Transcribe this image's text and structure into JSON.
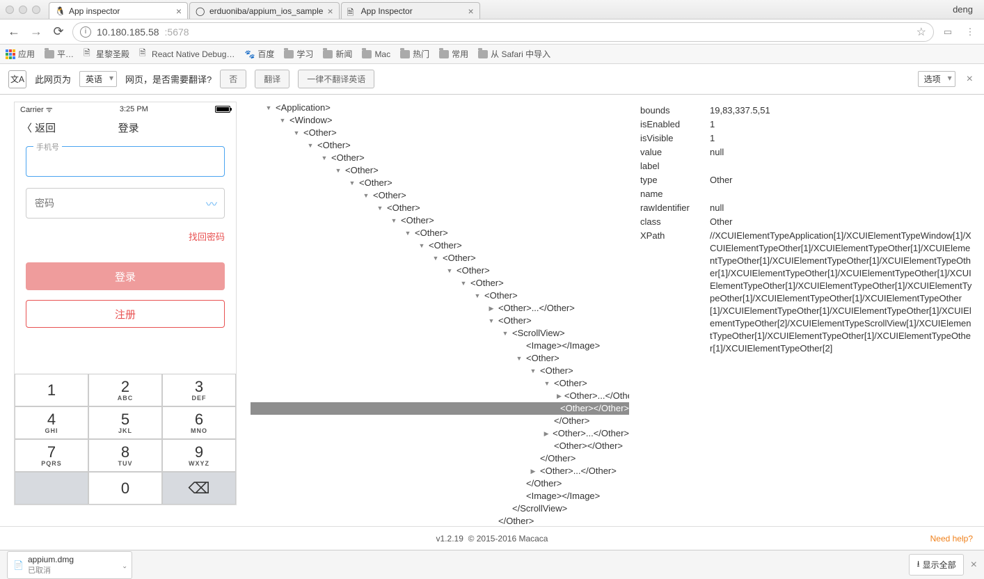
{
  "chrome": {
    "tabs": [
      {
        "title": "App inspector",
        "active": true,
        "fav": "tux"
      },
      {
        "title": "erduoniba/appium_ios_sample",
        "active": false,
        "fav": "github"
      },
      {
        "title": "App Inspector",
        "active": false,
        "fav": "doc"
      }
    ],
    "profile": "deng",
    "url_host": "10.180.185.58",
    "url_port": ":5678"
  },
  "bookmarks": {
    "apps": "应用",
    "items": [
      {
        "label": "平…",
        "folder": true
      },
      {
        "label": "星黎圣殿",
        "folder": false
      },
      {
        "label": "React Native Debug…",
        "folder": false
      },
      {
        "label": "百度",
        "folder": false,
        "icon": "paw"
      },
      {
        "label": "学习",
        "folder": true
      },
      {
        "label": "新闻",
        "folder": true
      },
      {
        "label": "Mac",
        "folder": true
      },
      {
        "label": "热门",
        "folder": true
      },
      {
        "label": "常用",
        "folder": true
      },
      {
        "label": "从 Safari 中导入",
        "folder": true
      }
    ]
  },
  "translate": {
    "prompt_pre": "此网页为",
    "lang": "英语",
    "prompt_post": "网页，是否需要翻译?",
    "no": "否",
    "yes": "翻译",
    "never": "一律不翻译英语",
    "options": "选项"
  },
  "phone": {
    "carrier": "Carrier",
    "time": "3:25 PM",
    "back": "返回",
    "title": "登录",
    "phone_label": "手机号",
    "pwd_placeholder": "密码",
    "forgot": "找回密码",
    "login_btn": "登录",
    "register_btn": "注册",
    "keys": [
      {
        "n": "1",
        "s": ""
      },
      {
        "n": "2",
        "s": "ABC"
      },
      {
        "n": "3",
        "s": "DEF"
      },
      {
        "n": "4",
        "s": "GHI"
      },
      {
        "n": "5",
        "s": "JKL"
      },
      {
        "n": "6",
        "s": "MNO"
      },
      {
        "n": "7",
        "s": "PQRS"
      },
      {
        "n": "8",
        "s": "TUV"
      },
      {
        "n": "9",
        "s": "WXYZ"
      },
      {
        "n": "",
        "s": ""
      },
      {
        "n": "0",
        "s": ""
      },
      {
        "n": "⌫",
        "s": ""
      }
    ]
  },
  "tree": [
    {
      "d": 0,
      "t": "<Application>",
      "tog": "▼"
    },
    {
      "d": 1,
      "t": "<Window>",
      "tog": "▼"
    },
    {
      "d": 2,
      "t": "<Other>",
      "tog": "▼"
    },
    {
      "d": 3,
      "t": "<Other>",
      "tog": "▼"
    },
    {
      "d": 4,
      "t": "<Other>",
      "tog": "▼"
    },
    {
      "d": 5,
      "t": "<Other>",
      "tog": "▼"
    },
    {
      "d": 6,
      "t": "<Other>",
      "tog": "▼"
    },
    {
      "d": 7,
      "t": "<Other>",
      "tog": "▼"
    },
    {
      "d": 8,
      "t": "<Other>",
      "tog": "▼"
    },
    {
      "d": 9,
      "t": "<Other>",
      "tog": "▼"
    },
    {
      "d": 10,
      "t": "<Other>",
      "tog": "▼"
    },
    {
      "d": 11,
      "t": "<Other>",
      "tog": "▼"
    },
    {
      "d": 12,
      "t": "<Other>",
      "tog": "▼"
    },
    {
      "d": 13,
      "t": "<Other>",
      "tog": "▼"
    },
    {
      "d": 14,
      "t": "<Other>",
      "tog": "▼"
    },
    {
      "d": 15,
      "t": "<Other>",
      "tog": "▼"
    },
    {
      "d": 16,
      "t": "<Other>...</Other>",
      "tog": "▶"
    },
    {
      "d": 16,
      "t": "<Other>",
      "tog": "▼"
    },
    {
      "d": 17,
      "t": "<ScrollView>",
      "tog": "▼"
    },
    {
      "d": 18,
      "t": "<Image></Image>",
      "tog": ""
    },
    {
      "d": 18,
      "t": "<Other>",
      "tog": "▼"
    },
    {
      "d": 19,
      "t": "<Other>",
      "tog": "▼"
    },
    {
      "d": 20,
      "t": "<Other>",
      "tog": "▼"
    },
    {
      "d": 21,
      "t": "<Other>...</Other>",
      "tog": "▶"
    },
    {
      "d": 21,
      "t": "<Other></Other>",
      "tog": "",
      "sel": true
    },
    {
      "d": 20,
      "t": "</Other>",
      "tog": ""
    },
    {
      "d": 20,
      "t": "<Other>...</Other>",
      "tog": "▶"
    },
    {
      "d": 20,
      "t": "<Other></Other>",
      "tog": ""
    },
    {
      "d": 19,
      "t": "</Other>",
      "tog": ""
    },
    {
      "d": 19,
      "t": "<Other>...</Other>",
      "tog": "▶"
    },
    {
      "d": 18,
      "t": "</Other>",
      "tog": ""
    },
    {
      "d": 18,
      "t": "<Image></Image>",
      "tog": ""
    },
    {
      "d": 17,
      "t": "</ScrollView>",
      "tog": ""
    },
    {
      "d": 16,
      "t": "</Other>",
      "tog": ""
    }
  ],
  "props": [
    {
      "k": "bounds",
      "v": "19,83,337.5,51"
    },
    {
      "k": "isEnabled",
      "v": "1"
    },
    {
      "k": "isVisible",
      "v": "1"
    },
    {
      "k": "value",
      "v": "null"
    },
    {
      "k": "label",
      "v": ""
    },
    {
      "k": "type",
      "v": "Other"
    },
    {
      "k": "name",
      "v": ""
    },
    {
      "k": "rawIdentifier",
      "v": "null"
    },
    {
      "k": "class",
      "v": "Other"
    },
    {
      "k": "XPath",
      "v": "//XCUIElementTypeApplication[1]/XCUIElementTypeWindow[1]/XCUIElementTypeOther[1]/XCUIElementTypeOther[1]/XCUIElementTypeOther[1]/XCUIElementTypeOther[1]/XCUIElementTypeOther[1]/XCUIElementTypeOther[1]/XCUIElementTypeOther[1]/XCUIElementTypeOther[1]/XCUIElementTypeOther[1]/XCUIElementTypeOther[1]/XCUIElementTypeOther[1]/XCUIElementTypeOther[1]/XCUIElementTypeOther[1]/XCUIElementTypeOther[1]/XCUIElementTypeOther[2]/XCUIElementTypeScrollView[1]/XCUIElementTypeOther[1]/XCUIElementTypeOther[1]/XCUIElementTypeOther[1]/XCUIElementTypeOther[2]"
    }
  ],
  "footer": {
    "version": "v1.2.19",
    "copyright": "© 2015-2016 Macaca",
    "help": "Need help?"
  },
  "download": {
    "file": "appium.dmg",
    "status": "已取消",
    "show_all": "显示全部"
  }
}
